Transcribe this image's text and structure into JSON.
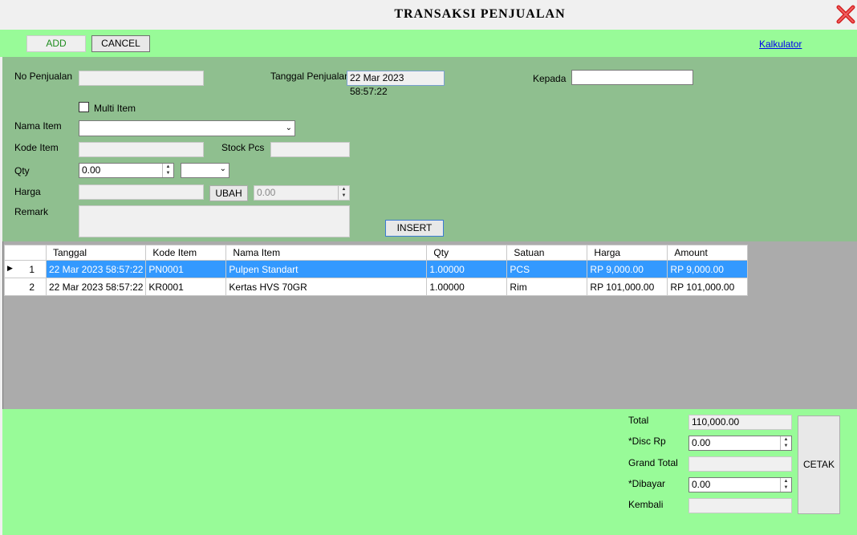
{
  "window": {
    "title": "TRANSAKSI PENJUALAN"
  },
  "toolbar": {
    "add_label": "ADD",
    "cancel_label": "CANCEL",
    "kalkulator_label": "Kalkulator"
  },
  "form": {
    "no_penjualan_label": "No Penjualan",
    "no_penjualan_value": "",
    "tanggal_label": "Tanggal Penjualan",
    "tanggal_value": "22 Mar 2023 58:57:22",
    "kepada_label": "Kepada",
    "kepada_value": "",
    "multi_item_label": "Multi Item",
    "nama_item_label": "Nama Item",
    "nama_item_value": "",
    "kode_item_label": "Kode Item",
    "stock_label": "Stock Pcs",
    "qty_label": "Qty",
    "qty_value": "0.00",
    "harga_label": "Harga",
    "ubah_label": "UBAH",
    "ubah_value": "0.00",
    "remark_label": "Remark",
    "insert_label": "INSERT"
  },
  "grid": {
    "columns": [
      "Tanggal",
      "Kode Item",
      "Nama Item",
      "Qty",
      "Satuan",
      "Harga",
      "Amount"
    ],
    "rows": [
      {
        "no": "1",
        "cells": [
          "22 Mar 2023 58:57:22",
          "PN0001",
          "Pulpen Standart",
          "1.00000",
          "PCS",
          "RP 9,000.00",
          "RP 9,000.00"
        ]
      },
      {
        "no": "2",
        "cells": [
          "22 Mar 2023 58:57:22",
          "KR0001",
          "Kertas HVS 70GR",
          "1.00000",
          "Rim",
          "RP 101,000.00",
          "RP 101,000.00"
        ]
      }
    ]
  },
  "summary": {
    "total_label": "Total",
    "total_value": "110,000.00",
    "disc_label": "*Disc Rp",
    "disc_value": "0.00",
    "grand_label": "Grand Total",
    "grand_value": "",
    "dibayar_label": "*Dibayar",
    "dibayar_value": "0.00",
    "kembali_label": "Kembali",
    "kembali_value": "",
    "cetak_label": "CETAK"
  }
}
